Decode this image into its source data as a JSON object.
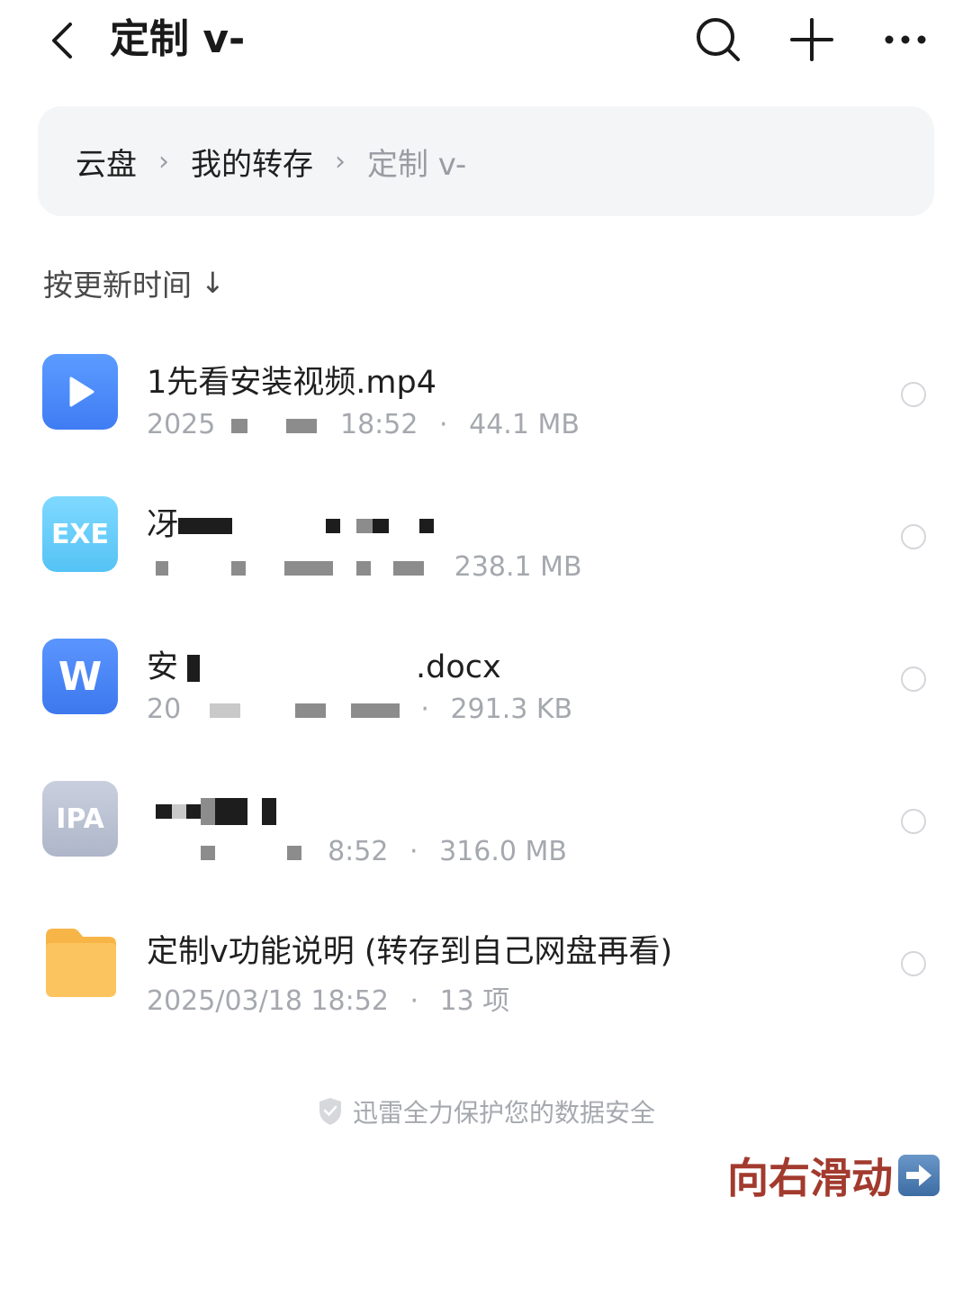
{
  "header": {
    "title": "定制 v-",
    "back_icon": "chevron-left-icon",
    "search_icon": "search-icon",
    "add_icon": "plus-icon",
    "more_icon": "more-icon"
  },
  "breadcrumb": {
    "items": [
      "云盘",
      "我的转存",
      "定制 v-"
    ],
    "separator": "›"
  },
  "sort": {
    "label": "按更新时间",
    "arrow": "↓"
  },
  "files": [
    {
      "name": "1先看安装视频.mp4",
      "date": "2025",
      "time": "18:52",
      "size": "44.1 MB",
      "type": "video"
    },
    {
      "name": "冴",
      "date": "",
      "time": "",
      "size": "238.1 MB",
      "type": "exe",
      "icon_label": "EXE"
    },
    {
      "name_prefix": "安",
      "name_suffix": ".docx",
      "date": "20",
      "time": "",
      "size": "291.3 KB",
      "type": "word",
      "icon_label": "W"
    },
    {
      "name": "",
      "date": "",
      "time": "8:52",
      "size": "316.0 MB",
      "type": "ipa",
      "icon_label": "IPA"
    },
    {
      "name": "定制v功能说明 (转存到自己网盘再看)",
      "date": "2025/03/18",
      "time": "18:52",
      "size": "13 项",
      "type": "folder"
    }
  ],
  "meta_separator": "·",
  "footer": {
    "security_text": "迅雷全力保护您的数据安全",
    "swipe_hint": "向右滑动"
  },
  "colors": {
    "accent_blue": "#3f7cf4",
    "folder_yellow": "#f7b548",
    "swipe_text": "#a23a2e"
  }
}
